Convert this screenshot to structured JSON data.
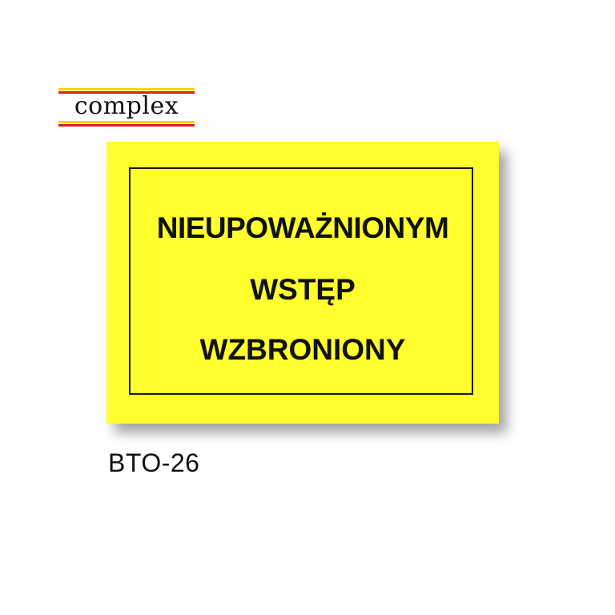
{
  "brand": {
    "logo_text": "complex",
    "colors": {
      "yellow": "#f5d400",
      "red": "#d62020"
    }
  },
  "sign": {
    "lines": [
      "NIEUPOWAŻNIONYM",
      "WSTĘP",
      "WZBRONIONY"
    ],
    "background_color": "#ffff2e",
    "text_color": "#111111"
  },
  "product_code": "BTO-26"
}
